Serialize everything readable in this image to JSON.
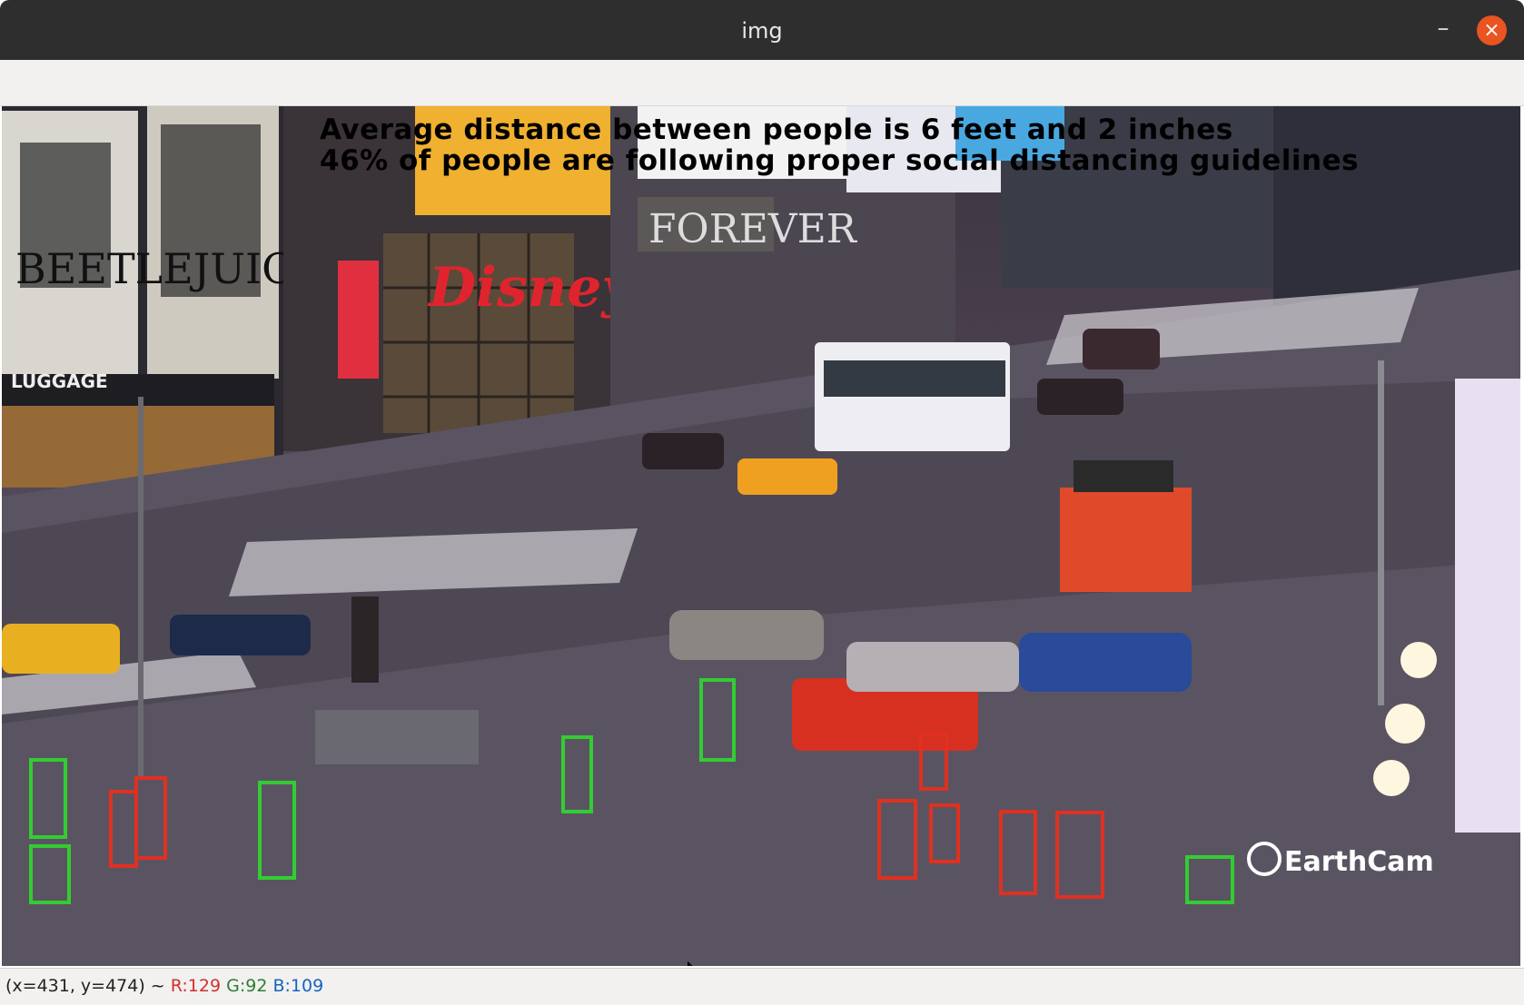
{
  "window": {
    "title": "img",
    "minimize_label": "–",
    "close_label": "×",
    "accent_close": "#e95420"
  },
  "overlay": {
    "line1": "Average distance between people is 6 feet and 2 inches",
    "line2": "46% of people are following proper social distancing guidelines"
  },
  "scene": {
    "billboard_beetlejuice": "BEETLEJUICE",
    "store_disney": "Disney",
    "store_forever": "FOREVER",
    "sign_luggage": "LUGGAGE",
    "watermark": "EarthCam",
    "box_colors": {
      "compliant": "#33cc33",
      "violation": "#e03020"
    }
  },
  "status": {
    "coords": "(x=431, y=474) ~",
    "r": "R:129",
    "g": "G:92",
    "b": "B:109"
  }
}
